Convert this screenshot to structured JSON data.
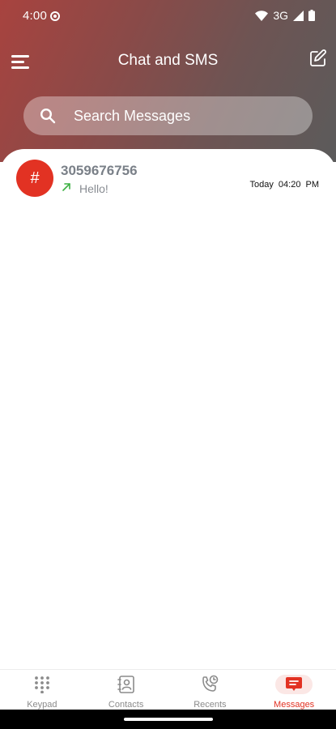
{
  "status_bar": {
    "time": "4:00",
    "network": "3G"
  },
  "header": {
    "title": "Chat and SMS"
  },
  "search": {
    "placeholder": "Search Messages"
  },
  "conversations": [
    {
      "avatar_text": "#",
      "name": "3059676756",
      "preview": "Hello!",
      "direction_icon": "outgoing-arrow-icon",
      "time": "Today  04:20 PM"
    }
  ],
  "bottom_nav": {
    "items": [
      {
        "label": "Keypad",
        "icon": "keypad-icon",
        "active": false
      },
      {
        "label": "Contacts",
        "icon": "contacts-icon",
        "active": false
      },
      {
        "label": "Recents",
        "icon": "recents-icon",
        "active": false
      },
      {
        "label": "Messages",
        "icon": "messages-icon",
        "active": true
      }
    ]
  },
  "colors": {
    "accent": "#e23223",
    "header_gradient_start": "#a8433f",
    "header_gradient_end": "#5b5b5b",
    "outgoing_arrow": "#3cb043"
  }
}
